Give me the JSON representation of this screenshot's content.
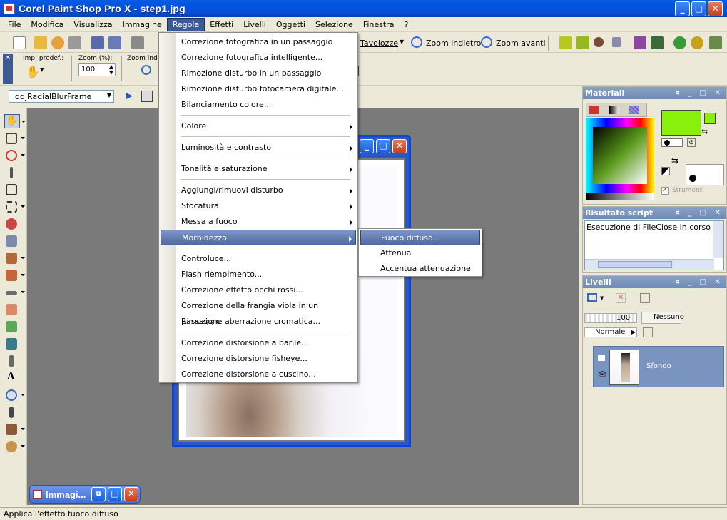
{
  "window": {
    "title": "Corel Paint Shop Pro X - step1.jpg"
  },
  "menubar": {
    "items": [
      "File",
      "Modifica",
      "Visualizza",
      "Immagine",
      "Regola",
      "Effetti",
      "Livelli",
      "Oggetti",
      "Selezione",
      "Finestra",
      "?"
    ],
    "active": "Regola"
  },
  "toolbar": {
    "tavolozze": "Tavolozze",
    "zoom_out": "Zoom indietro",
    "zoom_in": "Zoom avanti",
    "preset_label": "Imp. predef.:",
    "zoom_label": "Zoom (%):",
    "zoom_value": "100",
    "zoom_indie_label": "Zoom indie",
    "script_name": "ddjRadialBlurFrame"
  },
  "regola_menu": {
    "items": [
      "Correzione fotografica in un passaggio",
      "Correzione fotografica intelligente...",
      "Rimozione disturbo in un passaggio",
      "Rimozione disturbo fotocamera digitale...",
      "Bilanciamento colore...",
      "Colore",
      "Luminosità e contrasto",
      "Tonalità e saturazione",
      "Aggiungi/rimuovi disturbo",
      "Sfocatura",
      "Messa a fuoco",
      "Morbidezza",
      "Controluce...",
      "Flash riempimento...",
      "Correzione effetto occhi rossi...",
      "Correzione della frangia viola in un passaggio",
      "Rimozione aberrazione cromatica...",
      "Correzione distorsione a barile...",
      "Correzione distorsione fisheye...",
      "Correzione distorsione a cuscino..."
    ],
    "highlighted": "Morbidezza"
  },
  "submenu": {
    "items": [
      "Fuoco diffuso...",
      "Attenua",
      "Accentua attenuazione"
    ],
    "highlighted": "Fuoco diffuso..."
  },
  "panels": {
    "materiali": "Materiali",
    "strumenti": "Strumenti",
    "risultato": "Risultato script",
    "risultato_text": "Esecuzione di FileClose in corso",
    "livelli": "Livelli",
    "opacity": "100",
    "nessuno": "Nessuno",
    "blend": "Normale",
    "layer_name": "Sfondo"
  },
  "minimized": {
    "label": "Immagi..."
  },
  "status": {
    "text": "Applica l'effetto fuoco diffuso"
  },
  "colors": {
    "accent": "#3d5a96",
    "foreground": "#88f00a",
    "titlebar": "#0054e3"
  }
}
